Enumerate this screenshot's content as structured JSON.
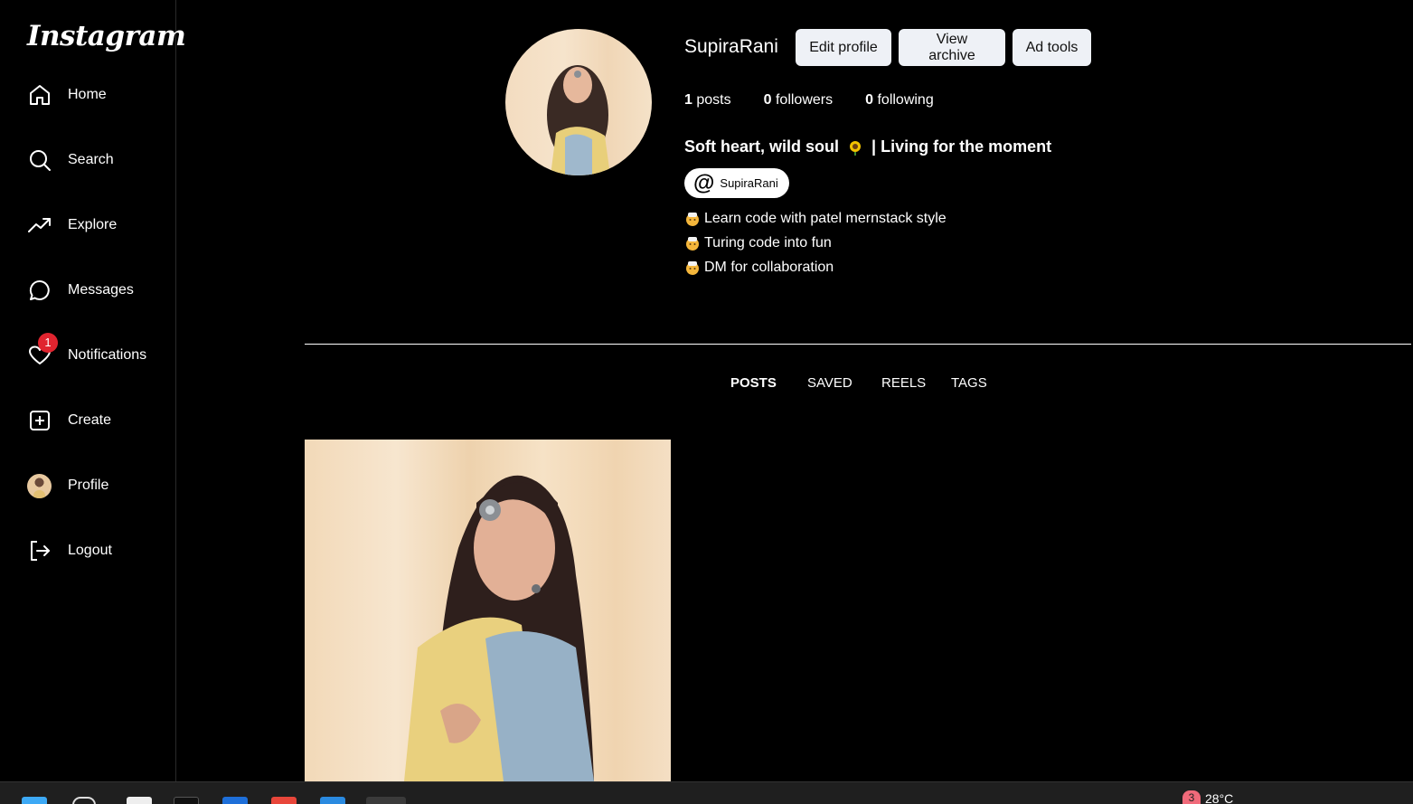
{
  "app": {
    "logo": "Instagram"
  },
  "sidebar": {
    "items": [
      {
        "label": "Home",
        "icon": "home-icon"
      },
      {
        "label": "Search",
        "icon": "search-icon"
      },
      {
        "label": "Explore",
        "icon": "trending-icon"
      },
      {
        "label": "Messages",
        "icon": "message-icon"
      },
      {
        "label": "Notifications",
        "icon": "heart-icon",
        "badge": "1"
      },
      {
        "label": "Create",
        "icon": "plus-square-icon"
      },
      {
        "label": "Profile",
        "icon": "avatar"
      },
      {
        "label": "Logout",
        "icon": "logout-icon"
      }
    ]
  },
  "profile": {
    "username": "SupiraRani",
    "buttons": {
      "edit": "Edit profile",
      "archive": "View archive",
      "ad_tools": "Ad tools"
    },
    "stats": {
      "posts_count": "1",
      "posts_label": "posts",
      "followers_count": "0",
      "followers_label": "followers",
      "following_count": "0",
      "following_label": "following"
    },
    "bio_title_start": "Soft heart, wild soul",
    "bio_title_end": "| Living for the moment",
    "handle": "SupiraRani",
    "handle_symbol": "@",
    "bio_lines": [
      "Learn code with patel mernstack style",
      "Turing code into fun",
      "DM for collaboration"
    ]
  },
  "tabs": [
    "POSTS",
    "SAVED",
    "REELS",
    "TAGS"
  ],
  "active_tab": "POSTS",
  "taskbar": {
    "weather_badge": "3",
    "temperature": "28°C"
  },
  "colors": {
    "background": "#000000",
    "badge": "#e0242f",
    "button_bg": "#eef1f6"
  }
}
